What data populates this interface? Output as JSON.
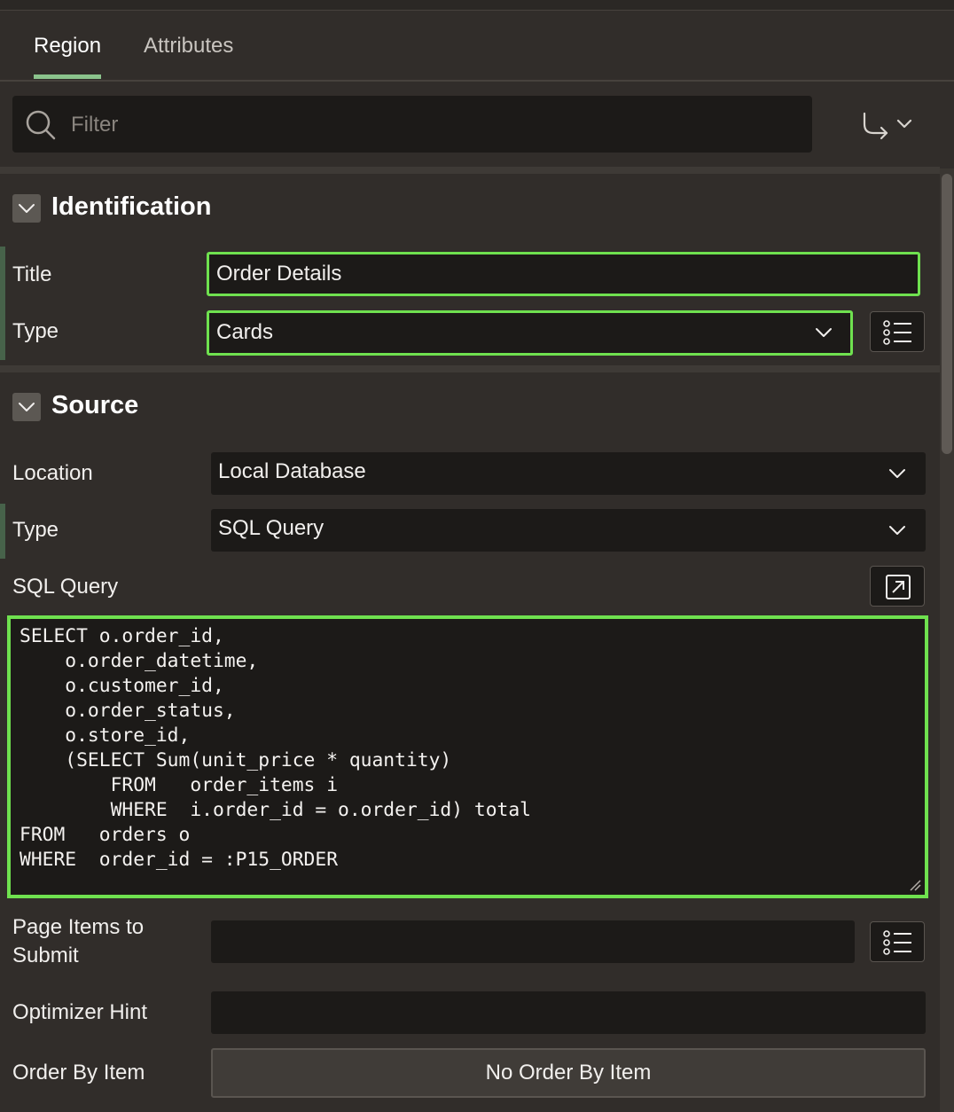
{
  "tabs": [
    {
      "label": "Region",
      "active": true
    },
    {
      "label": "Attributes",
      "active": false
    }
  ],
  "filter": {
    "placeholder": "Filter",
    "icon": "search-icon"
  },
  "goto_icon": "go-to-group-icon",
  "sections": {
    "identification": {
      "title": "Identification",
      "title_label": "Title",
      "title_value": "Order Details",
      "type_label": "Type",
      "type_value": "Cards"
    },
    "source": {
      "title": "Source",
      "location_label": "Location",
      "location_value": "Local Database",
      "type_label": "Type",
      "type_value": "SQL Query",
      "sql_label": "SQL Query",
      "sql_value": "SELECT o.order_id,\n    o.order_datetime,\n    o.customer_id,\n    o.order_status,\n    o.store_id,\n    (SELECT Sum(unit_price * quantity)\n        FROM   order_items i\n        WHERE  i.order_id = o.order_id) total\nFROM   orders o\nWHERE  order_id = :P15_ORDER",
      "page_items_label": "Page Items to Submit",
      "page_items_value": "",
      "optimizer_label": "Optimizer Hint",
      "optimizer_value": "",
      "order_by_label": "Order By Item",
      "order_by_button": "No Order By Item"
    }
  },
  "colors": {
    "background": "#312d2a",
    "field": "#1c1a18",
    "highlight": "#6fe14f",
    "tab_accent": "#8bc38c"
  }
}
